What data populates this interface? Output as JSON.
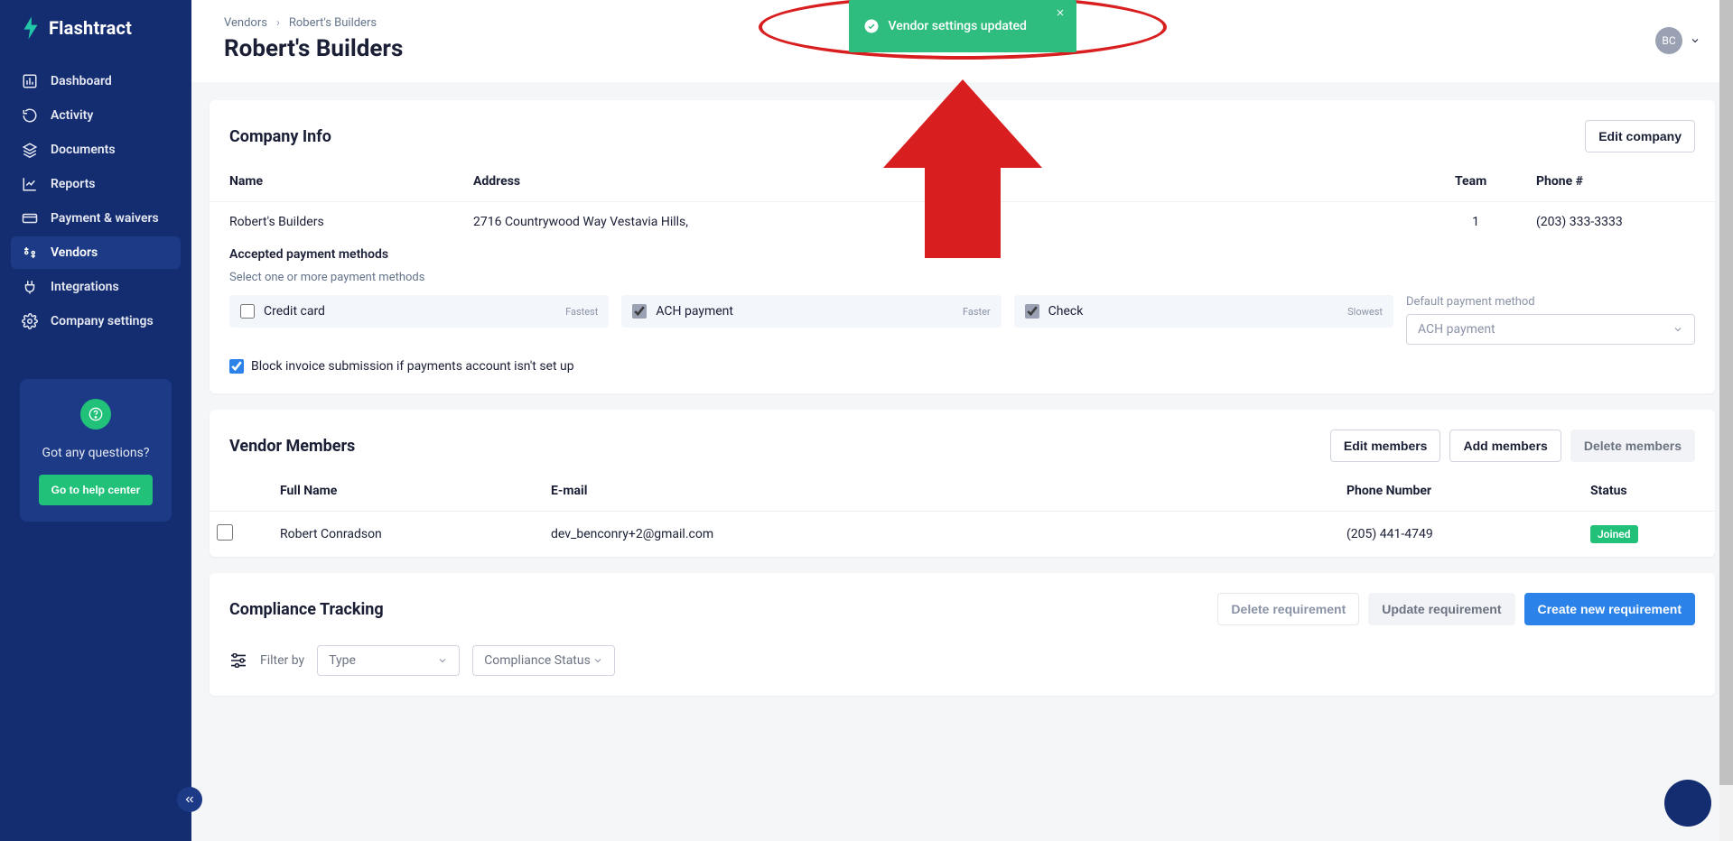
{
  "brand": {
    "name": "Flashtract"
  },
  "sidebar": {
    "items": [
      {
        "label": "Dashboard",
        "icon": "dashboard-icon"
      },
      {
        "label": "Activity",
        "icon": "activity-icon"
      },
      {
        "label": "Documents",
        "icon": "documents-icon"
      },
      {
        "label": "Reports",
        "icon": "reports-icon"
      },
      {
        "label": "Payment & waivers",
        "icon": "payment-icon"
      },
      {
        "label": "Vendors",
        "icon": "vendors-icon",
        "active": true
      },
      {
        "label": "Integrations",
        "icon": "integrations-icon"
      },
      {
        "label": "Company settings",
        "icon": "settings-icon"
      }
    ],
    "help": {
      "question": "Got any questions?",
      "cta": "Go to help center"
    }
  },
  "header": {
    "breadcrumb": {
      "root": "Vendors",
      "current": "Robert's Builders"
    },
    "title": "Robert's Builders",
    "user": {
      "initials": "BC"
    }
  },
  "toast": {
    "message": "Vendor settings updated"
  },
  "companyInfo": {
    "title": "Company Info",
    "editLabel": "Edit company",
    "columns": [
      "Name",
      "Address",
      "Team",
      "Phone #"
    ],
    "row": {
      "name": "Robert's Builders",
      "address": "2716 Countrywood Way Vestavia Hills,",
      "team": "1",
      "phone": "(203) 333-3333"
    },
    "paymentMethods": {
      "sectionTitle": "Accepted payment methods",
      "hint": "Select one or more payment methods",
      "options": [
        {
          "label": "Credit card",
          "tag": "Fastest",
          "checked": false
        },
        {
          "label": "ACH payment",
          "tag": "Faster",
          "checked": true
        },
        {
          "label": "Check",
          "tag": "Slowest",
          "checked": true
        }
      ],
      "defaultLabel": "Default payment method",
      "defaultValue": "ACH payment",
      "blockInvoice": {
        "checked": true,
        "label": "Block invoice submission if payments account isn't set up"
      }
    }
  },
  "members": {
    "title": "Vendor Members",
    "buttons": {
      "edit": "Edit members",
      "add": "Add members",
      "delete": "Delete members"
    },
    "columns": [
      "Full Name",
      "E-mail",
      "Phone Number",
      "Status"
    ],
    "rows": [
      {
        "name": "Robert Conradson",
        "email": "dev_benconry+2@gmail.com",
        "phone": "(205) 441-4749",
        "status": "Joined"
      }
    ]
  },
  "compliance": {
    "title": "Compliance Tracking",
    "buttons": {
      "delete": "Delete requirement",
      "update": "Update requirement",
      "create": "Create new requirement"
    },
    "filterLabel": "Filter by",
    "typeSelect": "Type",
    "statusSelect": "Compliance Status"
  }
}
